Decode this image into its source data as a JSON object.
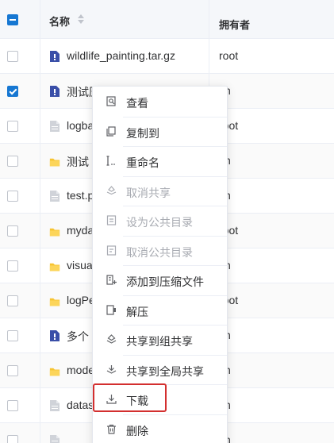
{
  "header": {
    "name_label": "名称",
    "owner_label": "拥有者"
  },
  "colors": {
    "accent": "#1677d2",
    "folder": "#f7c431",
    "archive": "#3a4fa8",
    "doc": "#c8cad0",
    "highlight": "#d32f2f"
  },
  "rows": [
    {
      "name": "wildlife_painting.tar.gz",
      "owner": "root",
      "icon": "archive-file-icon",
      "checked": false
    },
    {
      "name": "测试压缩包",
      "owner": "yh",
      "icon": "archive-file-icon",
      "checked": true
    },
    {
      "name": "logba",
      "owner": "root",
      "icon": "document-file-icon",
      "checked": false
    },
    {
      "name": "测试",
      "owner": "yh",
      "icon": "folder-icon",
      "checked": false
    },
    {
      "name": "test.p",
      "owner": "yh",
      "icon": "document-file-icon",
      "checked": false
    },
    {
      "name": "myda",
      "owner": "root",
      "icon": "folder-icon",
      "checked": false
    },
    {
      "name": "visua",
      "owner": "yh",
      "icon": "folder-icon",
      "checked": false
    },
    {
      "name": "logPe",
      "owner": "root",
      "icon": "folder-icon",
      "checked": false
    },
    {
      "name": "多个",
      "owner": "yh",
      "icon": "archive-file-icon",
      "checked": false
    },
    {
      "name": "mode",
      "owner": "yh",
      "icon": "folder-icon",
      "checked": false
    },
    {
      "name": "datas",
      "owner": "yh",
      "icon": "document-file-icon",
      "checked": false
    },
    {
      "name": "",
      "owner": "yh",
      "icon": "document-file-icon",
      "checked": false
    }
  ],
  "menu": {
    "items": [
      {
        "label": "查看",
        "icon": "view-icon",
        "disabled": false
      },
      {
        "label": "复制到",
        "icon": "copy-icon",
        "disabled": false
      },
      {
        "label": "重命名",
        "icon": "rename-icon",
        "disabled": false
      },
      {
        "label": "取消共享",
        "icon": "unshare-icon",
        "disabled": true
      },
      {
        "label": "设为公共目录",
        "icon": "public-dir-icon",
        "disabled": true
      },
      {
        "label": "取消公共目录",
        "icon": "unpublic-dir-icon",
        "disabled": true
      },
      {
        "label": "添加到压缩文件",
        "icon": "compress-icon",
        "disabled": false
      },
      {
        "label": "解压",
        "icon": "extract-icon",
        "disabled": false
      },
      {
        "label": "共享到组共享",
        "icon": "share-group-icon",
        "disabled": false
      },
      {
        "label": "共享到全局共享",
        "icon": "share-global-icon",
        "disabled": false
      },
      {
        "label": "下载",
        "icon": "download-icon",
        "disabled": false
      },
      {
        "label": "删除",
        "icon": "delete-icon",
        "disabled": false
      }
    ]
  }
}
